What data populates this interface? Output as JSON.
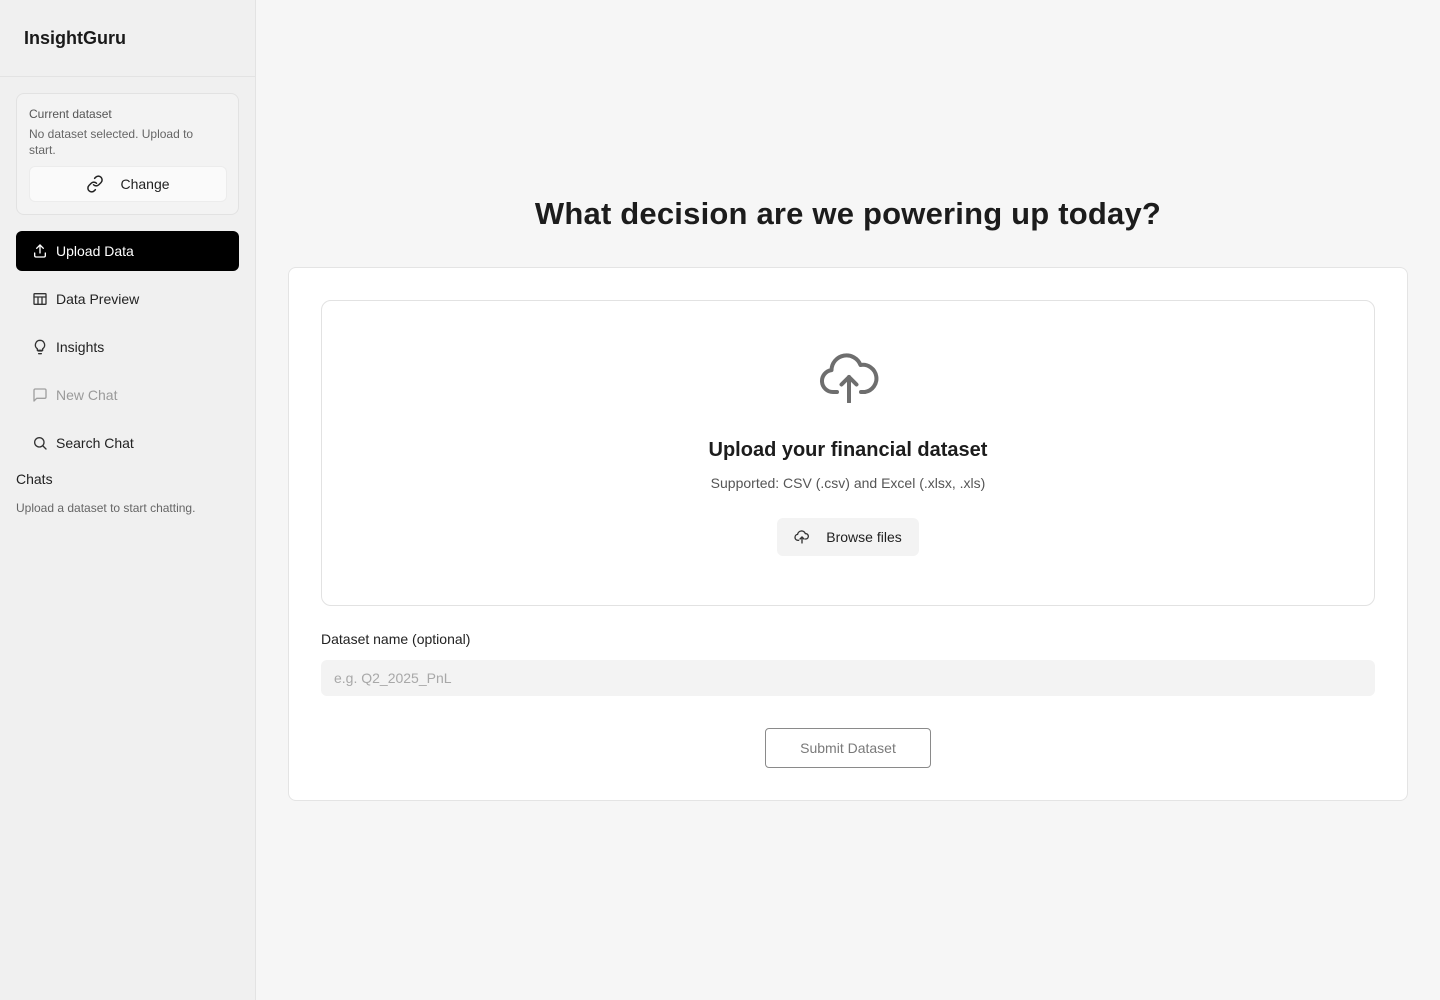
{
  "brand": "InsightGuru",
  "dataset_card": {
    "label": "Current dataset",
    "status": "No dataset selected. Upload to start.",
    "change_label": "Change"
  },
  "nav": {
    "items": [
      {
        "label": "Upload Data",
        "icon": "upload-icon",
        "active": true
      },
      {
        "label": "Data Preview",
        "icon": "table-icon"
      },
      {
        "label": "Insights",
        "icon": "lightbulb-icon"
      },
      {
        "label": "New Chat",
        "icon": "chat-bubble-icon",
        "disabled": true
      },
      {
        "label": "Search Chat",
        "icon": "search-icon"
      }
    ]
  },
  "chats": {
    "title": "Chats",
    "empty_text": "Upload a dataset to start chatting."
  },
  "main": {
    "headline": "What decision are we powering up today?",
    "dropzone": {
      "icon": "cloud-upload-icon",
      "title": "Upload your financial dataset",
      "subtitle": "Supported: CSV (.csv) and Excel (.xlsx, .xls)",
      "browse_label": "Browse files"
    },
    "dataset_name": {
      "label": "Dataset name (optional)",
      "placeholder": "e.g. Q2_2025_PnL",
      "value": ""
    },
    "submit_label": "Submit Dataset"
  },
  "colors": {
    "active_nav_bg": "#000000",
    "page_bg": "#f6f6f6",
    "sidebar_bg": "#f0f0f0"
  }
}
